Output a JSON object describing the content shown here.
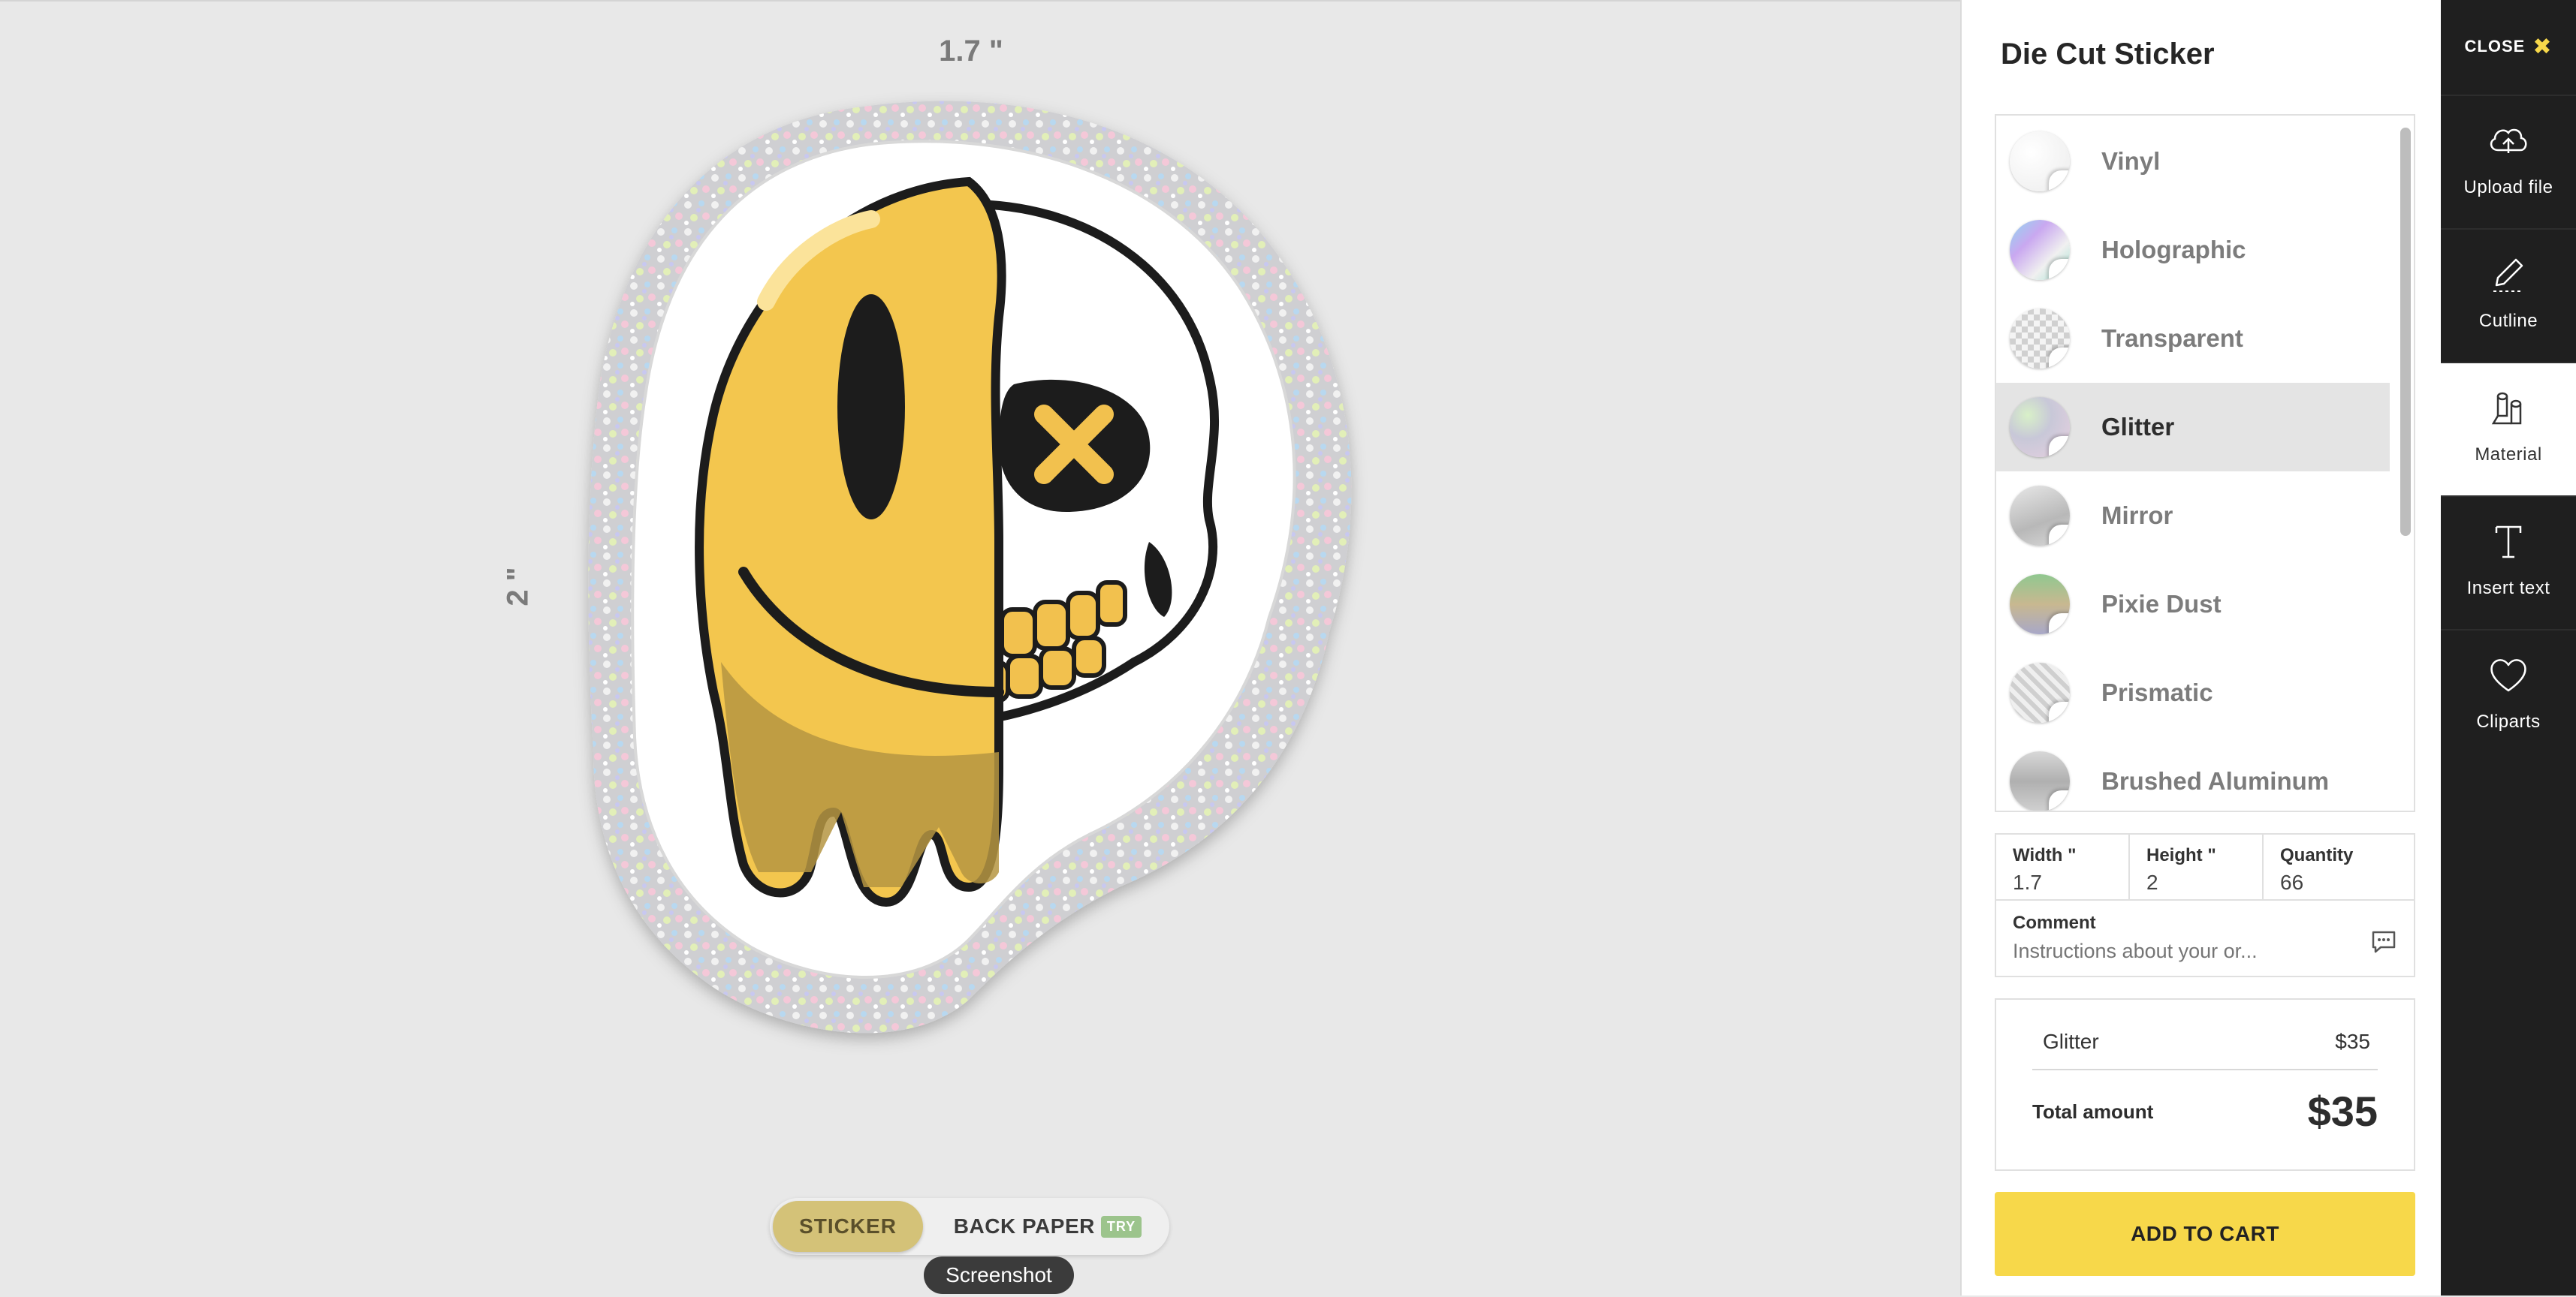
{
  "canvas": {
    "width_label": "1.7 \"",
    "height_label": "2 \"",
    "toggle": {
      "sticker": "STICKER",
      "back_paper": "BACK PAPER",
      "try_badge": "TRY"
    },
    "tooltip": "Screenshot"
  },
  "panel": {
    "title": "Die Cut Sticker",
    "materials": [
      {
        "label": "Vinyl",
        "thumb": "vinyl-swatch",
        "selected": false
      },
      {
        "label": "Holographic",
        "thumb": "holographic-swatch",
        "selected": false
      },
      {
        "label": "Transparent",
        "thumb": "transparent-swatch",
        "selected": false
      },
      {
        "label": "Glitter",
        "thumb": "glitter-swatch",
        "selected": true
      },
      {
        "label": "Mirror",
        "thumb": "mirror-swatch",
        "selected": false
      },
      {
        "label": "Pixie Dust",
        "thumb": "pixie-dust-swatch",
        "selected": false
      },
      {
        "label": "Prismatic",
        "thumb": "prismatic-swatch",
        "selected": false
      },
      {
        "label": "Brushed Aluminum",
        "thumb": "brushed-aluminum-swatch",
        "selected": false
      }
    ],
    "width": {
      "label": "Width \"",
      "value": "1.7"
    },
    "height": {
      "label": "Height \"",
      "value": "2"
    },
    "quantity": {
      "label": "Quantity",
      "value": "66"
    },
    "comment": {
      "label": "Comment",
      "placeholder": "Instructions about your or..."
    },
    "price": {
      "item_name": "Glitter",
      "item_price": "$35",
      "total_label": "Total amount",
      "total_value": "$35"
    },
    "add_to_cart": "ADD TO CART"
  },
  "rail": {
    "close": "CLOSE",
    "tools": [
      {
        "label": "Upload file",
        "icon": "upload-cloud-icon",
        "active": false
      },
      {
        "label": "Cutline",
        "icon": "pencil-icon",
        "active": false
      },
      {
        "label": "Material",
        "icon": "material-rolls-icon",
        "active": true
      },
      {
        "label": "Insert text",
        "icon": "text-icon",
        "active": false
      },
      {
        "label": "Cliparts",
        "icon": "heart-icon",
        "active": false
      }
    ]
  },
  "colors": {
    "accent_yellow": "#f7d84a",
    "toggle_gold": "#d4c278",
    "rail_dark": "#1f1f1f",
    "try_green": "#9cc48c"
  }
}
